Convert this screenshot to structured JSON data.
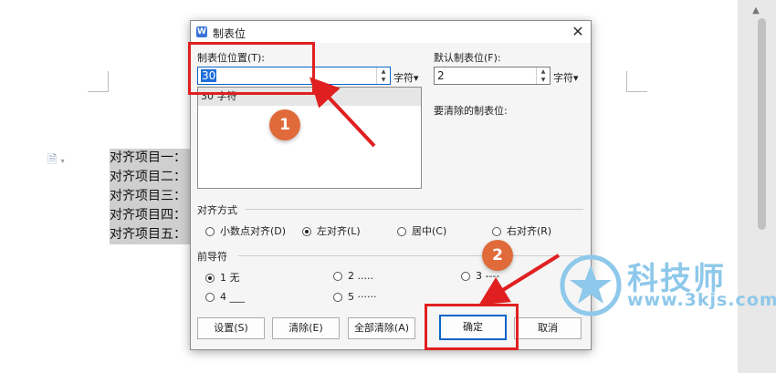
{
  "document": {
    "lines": [
      "对齐项目一：",
      "对齐项目二：",
      "对齐项目三：",
      "对齐项目四：",
      "对齐项目五："
    ]
  },
  "dialog": {
    "app_icon": "W",
    "title": "制表位",
    "close": "✕",
    "tab_pos_label": "制表位位置(T):",
    "tab_pos_value": "30",
    "tab_pos_unit": "字符▾",
    "tab_list": [
      "30 字符"
    ],
    "default_label": "默认制表位(F):",
    "default_value": "2",
    "default_unit": "字符▾",
    "clear_label": "要清除的制表位:",
    "align_group": "对齐方式",
    "align_options": [
      {
        "label": "小数点对齐(D)",
        "checked": false
      },
      {
        "label": "左对齐(L)",
        "checked": true
      },
      {
        "label": "居中(C)",
        "checked": false
      },
      {
        "label": "右对齐(R)",
        "checked": false
      }
    ],
    "leader_group": "前导符",
    "leader_options": [
      {
        "label": "1 无",
        "checked": true
      },
      {
        "label": "2 .....",
        "checked": false
      },
      {
        "label": "3 ----",
        "checked": false
      },
      {
        "label": "4 ___",
        "checked": false
      },
      {
        "label": "5 ······",
        "checked": false
      }
    ],
    "buttons": {
      "set": "设置(S)",
      "clear": "清除(E)",
      "clear_all": "全部清除(A)",
      "ok": "确定",
      "cancel": "取消"
    }
  },
  "annotations": {
    "badge1": "1",
    "badge2": "2",
    "color": "#e02020"
  },
  "watermark": {
    "brand": "科技师",
    "url": "www.3kjs.com"
  }
}
